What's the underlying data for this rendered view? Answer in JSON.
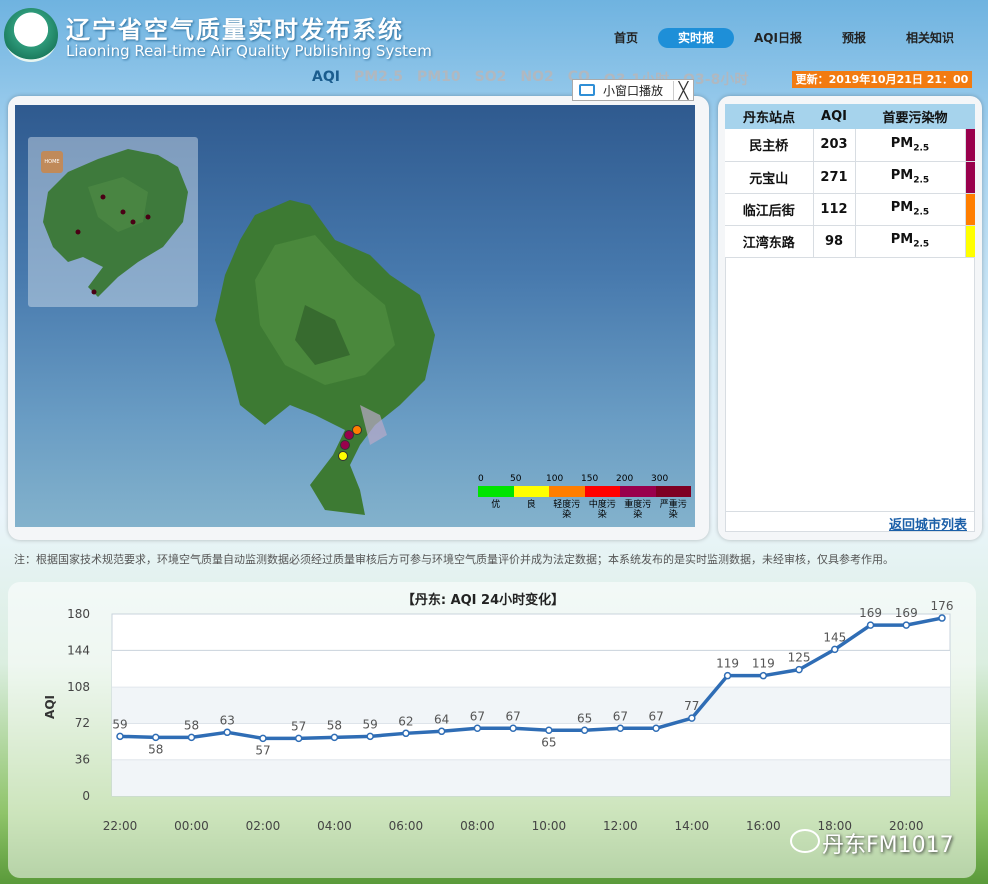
{
  "header": {
    "title_cn": "辽宁省空气质量实时发布系统",
    "title_en": "Liaoning Real-time Air Quality Publishing System",
    "nav": [
      "首页",
      "实时报",
      "AQI日报",
      "预报",
      "相关知识"
    ],
    "nav_active": "实时报"
  },
  "pollutants": [
    "AQI",
    "PM2.5",
    "PM10",
    "SO2",
    "NO2",
    "CO",
    "O3-1小时",
    "O3-8小时"
  ],
  "update_text": "更新：2019年10月21日 21：00",
  "map": {
    "home_label": "HOME",
    "popout_label": "小窗口播放",
    "close_symbol": "╳",
    "legend_ticks": [
      "0",
      "50",
      "100",
      "150",
      "200",
      "300"
    ],
    "legend_colors": [
      "#00e400",
      "#ffff00",
      "#ff7e00",
      "#ff0000",
      "#99004c",
      "#7e0023"
    ],
    "legend_labels": [
      "优",
      "良",
      "轻度污染",
      "中度污染",
      "重度污染",
      "严重污染"
    ]
  },
  "stations": {
    "headers": [
      "丹东站点",
      "AQI",
      "首要污染物"
    ],
    "rows": [
      {
        "name": "民主桥",
        "aqi": "203",
        "pollutant": "PM",
        "pollutant_sub": "2.5",
        "color": "#99004c"
      },
      {
        "name": "元宝山",
        "aqi": "271",
        "pollutant": "PM",
        "pollutant_sub": "2.5",
        "color": "#99004c"
      },
      {
        "name": "临江后街",
        "aqi": "112",
        "pollutant": "PM",
        "pollutant_sub": "2.5",
        "color": "#ff7e00"
      },
      {
        "name": "江湾东路",
        "aqi": "98",
        "pollutant": "PM",
        "pollutant_sub": "2.5",
        "color": "#ffff00"
      }
    ],
    "return_link": "返回城市列表"
  },
  "note": "注：根据国家技术规范要求，环境空气质量自动监测数据必须经过质量审核后方可参与环境空气质量评价并成为法定数据；本系统发布的是实时监测数据，未经审核，仅具参考作用。",
  "watermark": "丹东FM1017",
  "chart_data": {
    "type": "line",
    "title": "【丹东: AQI 24小时变化】",
    "ylabel": "AQI",
    "xlabel": "",
    "ylim": [
      0,
      180
    ],
    "yticks": [
      0,
      36,
      72,
      108,
      144,
      180
    ],
    "xtick_labels": [
      "22:00",
      "00:00",
      "02:00",
      "04:00",
      "06:00",
      "08:00",
      "10:00",
      "12:00",
      "14:00",
      "16:00",
      "18:00",
      "20:00"
    ],
    "x": [
      "22:00",
      "23:00",
      "00:00",
      "01:00",
      "02:00",
      "03:00",
      "04:00",
      "05:00",
      "06:00",
      "07:00",
      "08:00",
      "09:00",
      "10:00",
      "11:00",
      "12:00",
      "13:00",
      "14:00",
      "15:00",
      "16:00",
      "17:00",
      "18:00",
      "19:00",
      "20:00",
      "21:00"
    ],
    "values": [
      59,
      58,
      58,
      63,
      57,
      57,
      58,
      59,
      62,
      64,
      67,
      67,
      65,
      65,
      67,
      67,
      77,
      119,
      119,
      125,
      145,
      169,
      169,
      176
    ],
    "color": "#2f6db5"
  }
}
